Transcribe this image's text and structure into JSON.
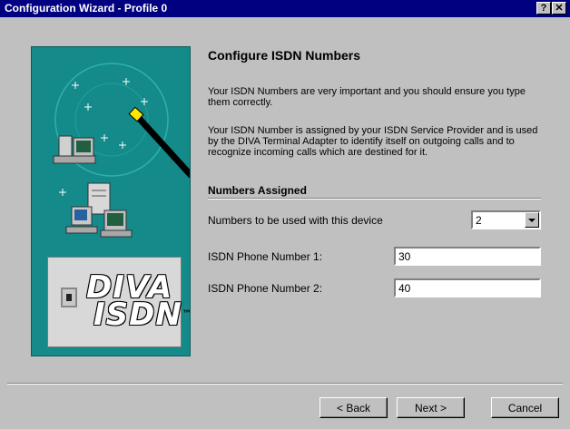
{
  "window": {
    "title": "Configuration Wizard - Profile 0",
    "help_button": "?",
    "close_button": "✕"
  },
  "panel": {
    "logo_line1": "DIVA",
    "logo_line2": "ISDN",
    "trademark": "™",
    "icons": [
      "magic-wand-icon",
      "computer-icon",
      "network-computers-icon",
      "isdn-port-icon"
    ],
    "background_color": "#148a8a"
  },
  "page": {
    "heading": "Configure ISDN Numbers",
    "paragraph1": "Your ISDN Numbers are very important and you should ensure you type them correctly.",
    "paragraph2": "Your ISDN Number is assigned by your ISDN Service Provider and is used by the DIVA Terminal Adapter to identify itself on outgoing calls and to recognize incoming calls which are destined for it.",
    "subheading": "Numbers Assigned"
  },
  "form": {
    "numbers_label": "Numbers to be used with this device",
    "numbers_value": "2",
    "phone1_label": "ISDN Phone Number 1:",
    "phone1_value": "30",
    "phone2_label": "ISDN Phone Number 2:",
    "phone2_value": "40"
  },
  "buttons": {
    "back": "< Back",
    "next": "Next >",
    "cancel": "Cancel"
  },
  "colors": {
    "titlebar": "#000080",
    "window": "#c0c0c0"
  }
}
